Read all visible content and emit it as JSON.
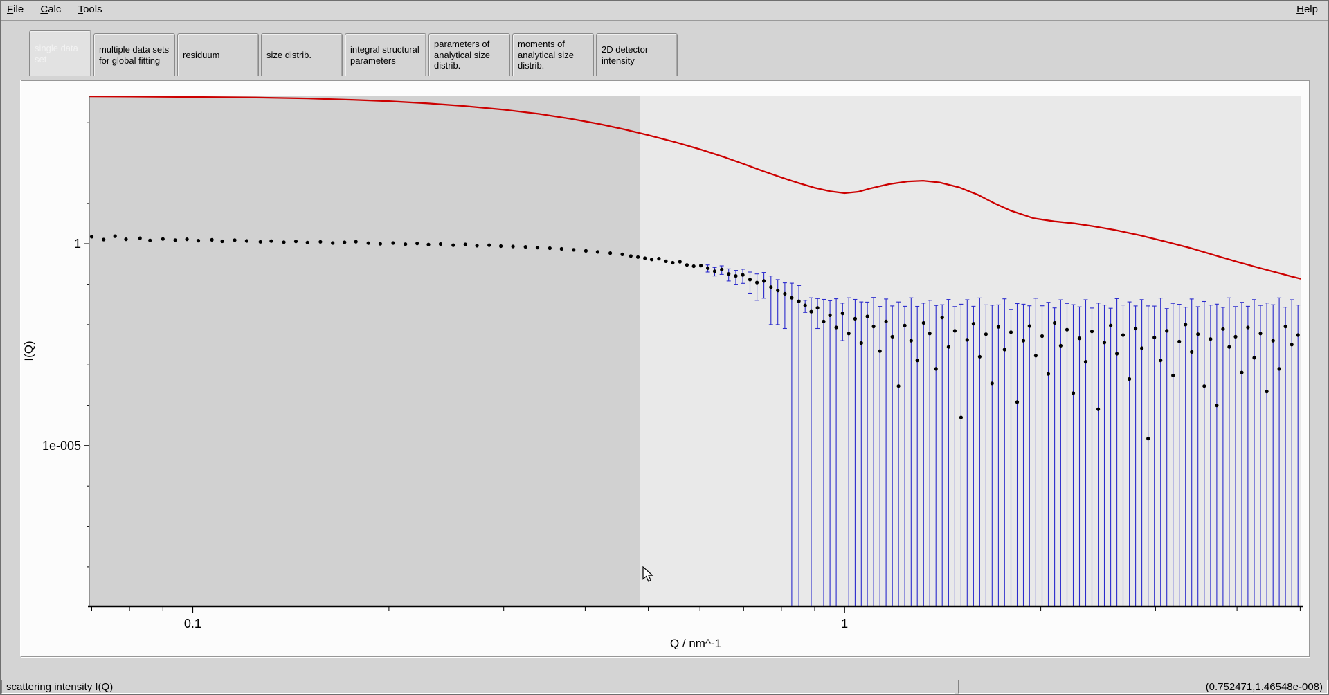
{
  "menu": {
    "items": [
      {
        "label": "File"
      },
      {
        "label": "Calc"
      },
      {
        "label": "Tools"
      }
    ],
    "help_label": "Help"
  },
  "tabs": [
    {
      "label": "single data set",
      "active": true
    },
    {
      "label": "multiple data sets for global fitting",
      "active": false
    },
    {
      "label": "residuum",
      "active": false
    },
    {
      "label": "size distrib.",
      "active": false
    },
    {
      "label": "integral structural parameters",
      "active": false
    },
    {
      "label": "parameters of analytical size distrib.",
      "active": false
    },
    {
      "label": "moments of analytical size distrib.",
      "active": false
    },
    {
      "label": "2D detector intensity",
      "active": false
    }
  ],
  "status_bar": {
    "left": "scattering intensity I(Q)",
    "right": "(0.752471,1.46548e-008)"
  },
  "chart_data": {
    "type": "scatter",
    "title": "",
    "xlabel": "Q / nm^-1",
    "ylabel": "I(Q)",
    "x_scale": "log",
    "y_scale": "log",
    "x_range": [
      0.0694,
      5.02
    ],
    "y_range": [
      1.05e-09,
      4700
    ],
    "x_ticks": [
      {
        "value": 0.1,
        "label": "0.1"
      },
      {
        "value": 1,
        "label": "1"
      }
    ],
    "y_ticks": [
      {
        "value": 1,
        "label": "1"
      },
      {
        "value": 1e-05,
        "label": "1e-005"
      }
    ],
    "x_minor_ticks": [
      0.07,
      0.08,
      0.09,
      0.2,
      0.3,
      0.4,
      0.5,
      0.6,
      0.7,
      0.8,
      0.9,
      2,
      3,
      4,
      5
    ],
    "y_minor_ticks": [
      1000,
      100,
      10,
      0.1,
      0.01,
      0.001,
      0.0001,
      1e-06,
      1e-07,
      1e-08
    ],
    "grid": false,
    "legend": false,
    "selection_region": {
      "q_min": 0.0694,
      "q_max": 0.486,
      "color": "#d1d1d1"
    },
    "colors": {
      "plot_bg": "#e9e9e9",
      "points": "#000000",
      "error_bars": "#2b2bcc",
      "model_curve": "#cc0000"
    },
    "model_curve": {
      "q": [
        0.069,
        0.08,
        0.1,
        0.125,
        0.15,
        0.175,
        0.2,
        0.23,
        0.26,
        0.3,
        0.34,
        0.38,
        0.42,
        0.46,
        0.5,
        0.55,
        0.6,
        0.65,
        0.7,
        0.75,
        0.8,
        0.85,
        0.9,
        0.95,
        1.0,
        1.05,
        1.1,
        1.17,
        1.25,
        1.32,
        1.4,
        1.5,
        1.6,
        1.7,
        1.8,
        1.95,
        2.1,
        2.25,
        2.4,
        2.6,
        2.85,
        3.1,
        3.4,
        3.7,
        4.0,
        4.3,
        4.6,
        4.85,
        5.02
      ],
      "i": [
        4500,
        4450,
        4350,
        4200,
        4000,
        3700,
        3400,
        3000,
        2600,
        2100,
        1650,
        1250,
        930,
        680,
        490,
        330,
        220,
        145,
        95,
        63,
        44,
        32,
        24.5,
        20,
        18,
        19.5,
        24,
        30,
        35,
        36.5,
        33,
        25,
        16.5,
        10,
        6.6,
        4.3,
        3.6,
        3.2,
        2.75,
        2.2,
        1.6,
        1.15,
        0.78,
        0.52,
        0.36,
        0.26,
        0.195,
        0.155,
        0.135
      ]
    },
    "data_points": [
      [
        0.07,
        1.5,
        0.02
      ],
      [
        0.073,
        1.28,
        0.02
      ],
      [
        0.076,
        1.55,
        0.02
      ],
      [
        0.079,
        1.3,
        0.02
      ],
      [
        0.083,
        1.38,
        0.02
      ],
      [
        0.086,
        1.22,
        0.02
      ],
      [
        0.09,
        1.32,
        0.02
      ],
      [
        0.094,
        1.24,
        0.02
      ],
      [
        0.098,
        1.3,
        0.02
      ],
      [
        0.102,
        1.2,
        0.02
      ],
      [
        0.107,
        1.26,
        0.02
      ],
      [
        0.111,
        1.16,
        0.02
      ],
      [
        0.116,
        1.24,
        0.02
      ],
      [
        0.121,
        1.18,
        0.02
      ],
      [
        0.127,
        1.12,
        0.02
      ],
      [
        0.132,
        1.17,
        0.02
      ],
      [
        0.138,
        1.1,
        0.02
      ],
      [
        0.144,
        1.15,
        0.02
      ],
      [
        0.15,
        1.08,
        0.02
      ],
      [
        0.157,
        1.12,
        0.02
      ],
      [
        0.164,
        1.05,
        0.02
      ],
      [
        0.171,
        1.09,
        0.02
      ],
      [
        0.178,
        1.13,
        0.02
      ],
      [
        0.186,
        1.04,
        0.02
      ],
      [
        0.194,
        1.0,
        0.02
      ],
      [
        0.203,
        1.05,
        0.02
      ],
      [
        0.212,
        0.98,
        0.02
      ],
      [
        0.221,
        1.02,
        0.02
      ],
      [
        0.23,
        0.96,
        0.02
      ],
      [
        0.24,
        0.99,
        0.02
      ],
      [
        0.251,
        0.93,
        0.02
      ],
      [
        0.262,
        0.97,
        0.02
      ],
      [
        0.273,
        0.9,
        0.02
      ],
      [
        0.285,
        0.93,
        0.02
      ],
      [
        0.297,
        0.88,
        0.02
      ],
      [
        0.31,
        0.86,
        0.02
      ],
      [
        0.324,
        0.84,
        0.02
      ],
      [
        0.338,
        0.81,
        0.02
      ],
      [
        0.353,
        0.78,
        0.02
      ],
      [
        0.368,
        0.75,
        0.02
      ],
      [
        0.384,
        0.71,
        0.02
      ],
      [
        0.401,
        0.67,
        0.02
      ],
      [
        0.418,
        0.63,
        0.02
      ],
      [
        0.437,
        0.59,
        0.02
      ],
      [
        0.456,
        0.55,
        0.02
      ],
      [
        0.47,
        0.5,
        0.01
      ],
      [
        0.482,
        0.47,
        0.012
      ],
      [
        0.494,
        0.44,
        0.015
      ],
      [
        0.506,
        0.41,
        0.018
      ],
      [
        0.519,
        0.43,
        0.02
      ],
      [
        0.532,
        0.37,
        0.025
      ],
      [
        0.545,
        0.34,
        0.03
      ],
      [
        0.559,
        0.36,
        0.03
      ],
      [
        0.573,
        0.3,
        0.035
      ],
      [
        0.587,
        0.28,
        0.04
      ],
      [
        0.602,
        0.29,
        0.045
      ],
      [
        0.617,
        0.25,
        0.05
      ],
      [
        0.632,
        0.21,
        0.05
      ],
      [
        0.648,
        0.23,
        0.055
      ],
      [
        0.664,
        0.18,
        0.06
      ],
      [
        0.681,
        0.16,
        0.06
      ],
      [
        0.698,
        0.17,
        0.065
      ],
      [
        0.716,
        0.13,
        0.07
      ],
      [
        0.734,
        0.11,
        0.07
      ],
      [
        0.752,
        0.12,
        0.075
      ],
      [
        0.771,
        0.085,
        0.075
      ],
      [
        0.79,
        0.07,
        0.06
      ],
      [
        0.81,
        0.058,
        0.05
      ],
      [
        0.83,
        0.046,
        0.06
      ],
      [
        0.851,
        0.038,
        0.055
      ],
      [
        0.87,
        0.03,
        0.01
      ],
      [
        0.889,
        0.021,
        0.025
      ],
      [
        0.909,
        0.026,
        0.018
      ],
      [
        0.929,
        0.012,
        0.03
      ],
      [
        0.95,
        0.017,
        0.022
      ],
      [
        0.971,
        0.0085,
        0.035
      ],
      [
        0.993,
        0.019,
        0.015
      ],
      [
        1.015,
        0.006,
        0.04
      ],
      [
        1.038,
        0.014,
        0.028
      ],
      [
        1.061,
        0.0035,
        0.033
      ],
      [
        1.084,
        0.016,
        0.02
      ],
      [
        1.108,
        0.009,
        0.038
      ],
      [
        1.133,
        0.0022,
        0.026
      ],
      [
        1.158,
        0.012,
        0.031
      ],
      [
        1.184,
        0.005,
        0.024
      ],
      [
        1.21,
        0.0003,
        0.036
      ],
      [
        1.237,
        0.0095,
        0.019
      ],
      [
        1.265,
        0.004,
        0.042
      ],
      [
        1.293,
        0.0013,
        0.027
      ],
      [
        1.322,
        0.011,
        0.023
      ],
      [
        1.351,
        0.006,
        0.034
      ],
      [
        1.381,
        0.0008,
        0.029
      ],
      [
        1.412,
        0.015,
        0.016
      ],
      [
        1.444,
        0.0028,
        0.039
      ],
      [
        1.476,
        0.007,
        0.021
      ],
      [
        1.509,
        5e-05,
        0.032
      ],
      [
        1.542,
        0.0042,
        0.037
      ],
      [
        1.577,
        0.0105,
        0.018
      ],
      [
        1.612,
        0.0016,
        0.044
      ],
      [
        1.648,
        0.0058,
        0.025
      ],
      [
        1.684,
        0.00035,
        0.03
      ],
      [
        1.722,
        0.0088,
        0.022
      ],
      [
        1.76,
        0.0024,
        0.041
      ],
      [
        1.8,
        0.0065,
        0.017
      ],
      [
        1.84,
        0.00012,
        0.033
      ],
      [
        1.881,
        0.004,
        0.028
      ],
      [
        1.922,
        0.0092,
        0.02
      ],
      [
        1.965,
        0.0017,
        0.043
      ],
      [
        2.009,
        0.0052,
        0.024
      ],
      [
        2.054,
        0.0006,
        0.035
      ],
      [
        2.1,
        0.011,
        0.015
      ],
      [
        2.146,
        0.003,
        0.038
      ],
      [
        2.194,
        0.0075,
        0.026
      ],
      [
        2.243,
        0.0002,
        0.031
      ],
      [
        2.293,
        0.0046,
        0.023
      ],
      [
        2.344,
        0.0012,
        0.04
      ],
      [
        2.396,
        0.0068,
        0.019
      ],
      [
        2.45,
        8e-05,
        0.034
      ],
      [
        2.504,
        0.0036,
        0.027
      ],
      [
        2.56,
        0.0095,
        0.016
      ],
      [
        2.617,
        0.0019,
        0.042
      ],
      [
        2.675,
        0.0055,
        0.025
      ],
      [
        2.735,
        0.00045,
        0.036
      ],
      [
        2.796,
        0.008,
        0.021
      ],
      [
        2.858,
        0.0026,
        0.039
      ],
      [
        2.922,
        1.5e-05,
        0.029
      ],
      [
        2.987,
        0.0048,
        0.024
      ],
      [
        3.054,
        0.0013,
        0.044
      ],
      [
        3.122,
        0.007,
        0.018
      ],
      [
        3.191,
        0.00055,
        0.033
      ],
      [
        3.262,
        0.0038,
        0.028
      ],
      [
        3.335,
        0.01,
        0.017
      ],
      [
        3.409,
        0.0021,
        0.041
      ],
      [
        3.485,
        0.0058,
        0.022
      ],
      [
        3.563,
        0.0003,
        0.037
      ],
      [
        3.643,
        0.0044,
        0.026
      ],
      [
        3.724,
        0.0001,
        0.032
      ],
      [
        3.807,
        0.0078,
        0.019
      ],
      [
        3.892,
        0.0028,
        0.043
      ],
      [
        3.979,
        0.005,
        0.023
      ],
      [
        4.068,
        0.00065,
        0.035
      ],
      [
        4.158,
        0.0085,
        0.02
      ],
      [
        4.251,
        0.0015,
        0.04
      ],
      [
        4.346,
        0.006,
        0.024
      ],
      [
        4.443,
        0.00022,
        0.034
      ],
      [
        4.543,
        0.004,
        0.027
      ],
      [
        4.643,
        0.0008,
        0.045
      ],
      [
        4.747,
        0.009,
        0.018
      ],
      [
        4.853,
        0.0032,
        0.038
      ],
      [
        4.961,
        0.0055,
        0.025
      ]
    ]
  }
}
